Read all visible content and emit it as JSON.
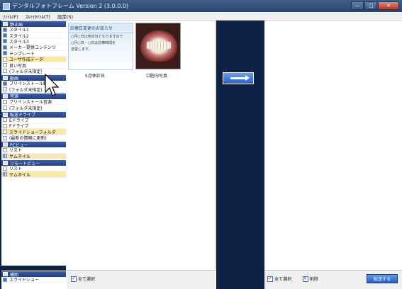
{
  "window": {
    "title": "デンタルフォトフレーム Version 2 (3.0.0.0)",
    "buttons": [
      "—",
      "□",
      "✕"
    ]
  },
  "menu": {
    "items": [
      "ﾌｧｲﾙ(F)",
      "ｽﾙｲｲﾀｲﾄﾙ(T)",
      "設定(S)"
    ]
  },
  "sidebar": {
    "sections": [
      {
        "header": "静止画",
        "items": [
          {
            "label": "スタイル1",
            "icon": "selected"
          },
          {
            "label": "スタイル2",
            "icon": "selected"
          },
          {
            "label": "スタイル3",
            "icon": "selected"
          },
          {
            "label": "メーカー提供コンテンツ",
            "icon": "selected"
          },
          {
            "label": "テンプレート",
            "icon": "selected"
          },
          {
            "label": "ユーザ作成データ",
            "icon": "folder",
            "highlight": true
          },
          {
            "label": "良い写真",
            "icon": "folder"
          },
          {
            "label": "(フォルダ未指定)",
            "icon": "folder"
          }
        ]
      },
      {
        "header": "動画",
        "items": [
          {
            "label": "プリインストール動画",
            "icon": "selected"
          },
          {
            "label": "(フォルダ未指定)",
            "icon": "folder"
          }
        ]
      },
      {
        "header": "音源",
        "items": [
          {
            "label": "プリインストール音源",
            "icon": "folder"
          },
          {
            "label": "(フォルダ未指定)",
            "icon": "folder"
          }
        ]
      },
      {
        "header": "転送ドライブ",
        "items": [
          {
            "label": "Eドライブ",
            "icon": "drive"
          },
          {
            "label": "Fドライブ",
            "icon": "drive"
          },
          {
            "label": "スライドショーフォルダ",
            "icon": "drive",
            "highlight": true
          },
          {
            "label": "(最新の情報に更新)",
            "icon": "drive"
          }
        ]
      },
      {
        "header": "PCビュー",
        "items": [
          {
            "label": "リスト",
            "icon": "list"
          },
          {
            "label": "サムネイル",
            "icon": "grid",
            "highlight": true
          }
        ]
      },
      {
        "header": "リモートビュー",
        "items": [
          {
            "label": "リスト",
            "icon": "list"
          },
          {
            "label": "サムネイル",
            "icon": "grid",
            "highlight": true
          }
        ]
      }
    ],
    "bottom": {
      "header": "補助",
      "item": "スライドショー"
    }
  },
  "center": {
    "notice": {
      "title": "診療日変更のお知らせ",
      "lines": [
        "○月○日は休診日となりますので",
        "○月○日・○日は診療時間を",
        "変更します。"
      ]
    },
    "thumbnails": [
      {
        "caption": "5月休診日"
      },
      {
        "caption": "口腔内写真"
      }
    ],
    "select_all_label": "全て選択"
  },
  "right": {
    "select_all_label": "全て選択",
    "delete_label": "削除",
    "transfer_label": "転送する"
  }
}
